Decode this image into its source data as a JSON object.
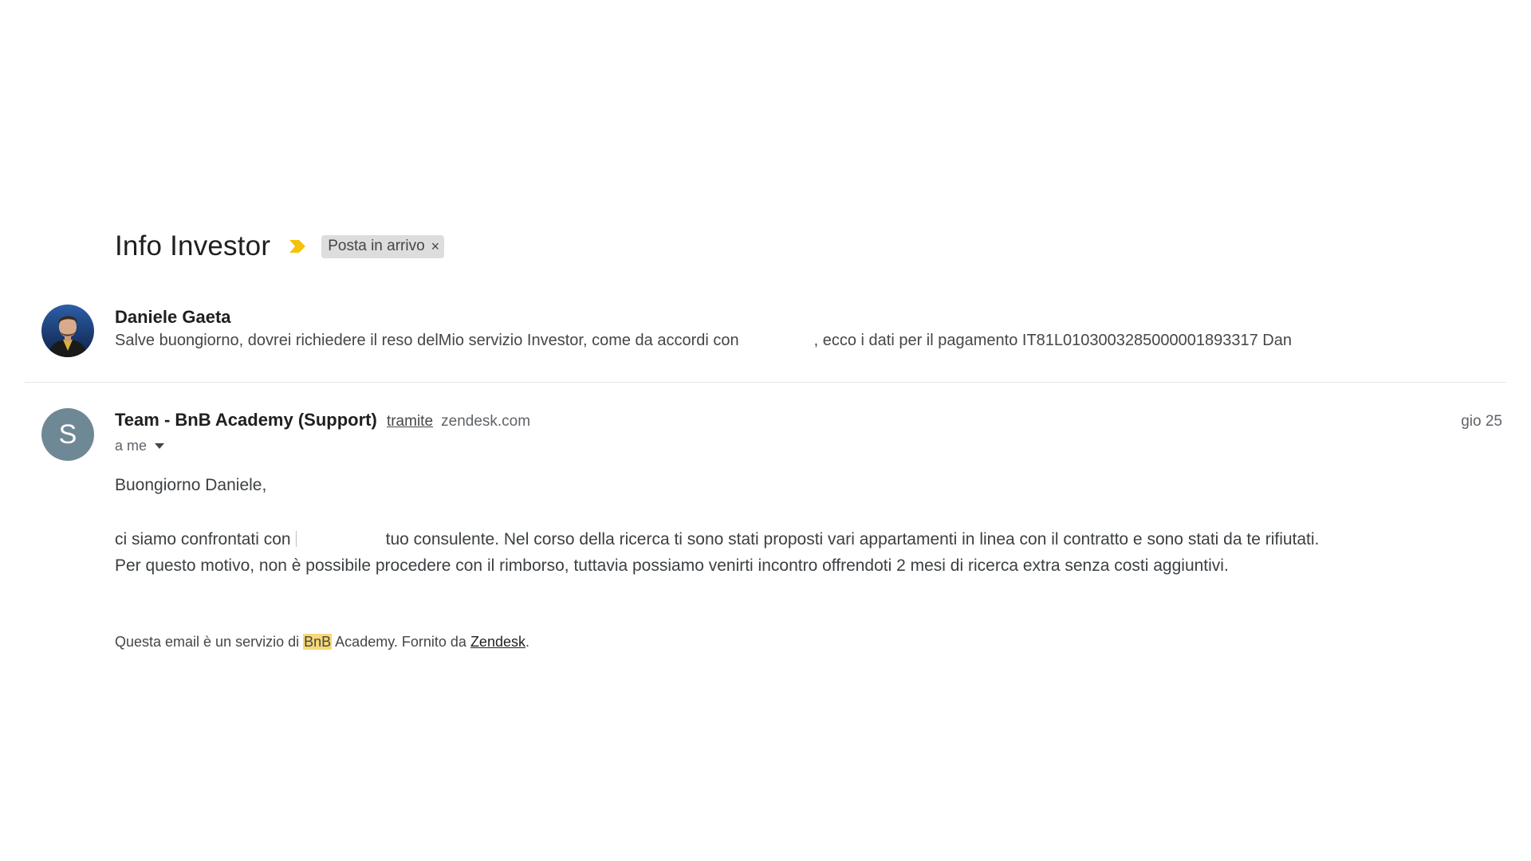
{
  "thread": {
    "subject": "Info Investor",
    "label": "Posta in arrivo",
    "label_remove": "×",
    "importance_color": "#f4c20d"
  },
  "message1": {
    "sender": "Daniele Gaeta",
    "snippet_part1": "Salve buongiorno, dovrei richiedere il reso delMio servizio Investor, come da accordi con",
    "snippet_part2": ", ecco i dati per il pagamento IT81L0103003285000001893317 Dan"
  },
  "message2": {
    "avatar_letter": "S",
    "avatar_color": "#6f8895",
    "sender": "Team - BnB Academy (Support)",
    "via": "tramite",
    "domain": "zendesk.com",
    "date": "gio 25",
    "to": "a me",
    "greeting": "Buongiorno Daniele,",
    "para1_part1": "ci siamo confrontati con",
    "para1_part2": "tuo consulente. Nel corso della ricerca ti sono stati proposti vari appartamenti in linea con il contratto e sono stati da te rifiutati.",
    "para2": "Per questo motivo, non è possibile procedere con il rimborso, tuttavia possiamo venirti incontro offrendoti 2 mesi di ricerca extra senza costi aggiuntivi.",
    "footer_part1": "Questa email è un servizio di",
    "footer_highlight": "BnB",
    "footer_part2": "Academy. Fornito da",
    "footer_link": "Zendesk",
    "footer_end": "."
  }
}
